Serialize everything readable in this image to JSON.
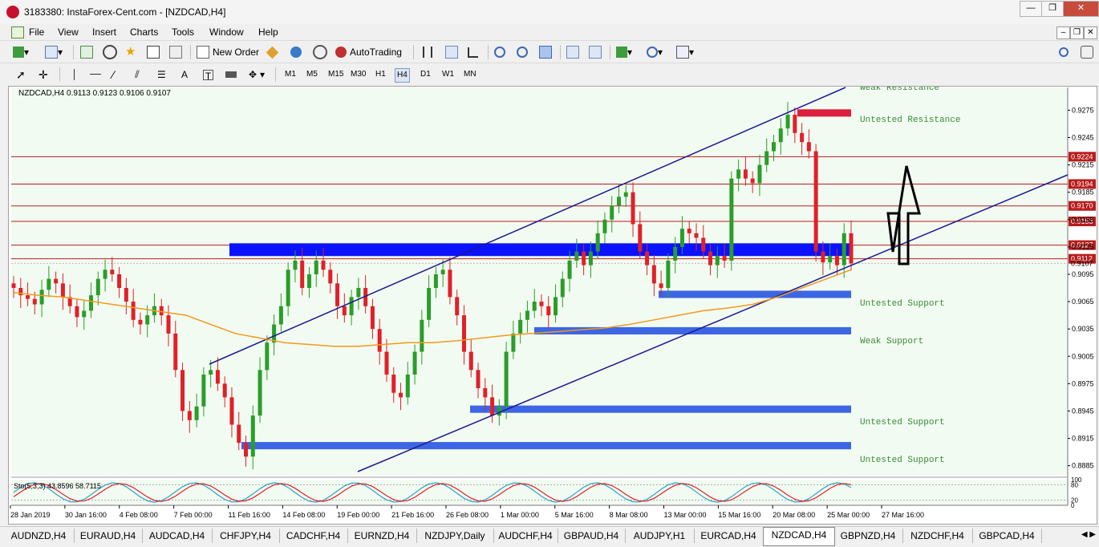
{
  "window": {
    "title": "3183380: InstaForex-Cent.com - [NZDCAD,H4]"
  },
  "menu": [
    "File",
    "View",
    "Insert",
    "Charts",
    "Tools",
    "Window",
    "Help"
  ],
  "toolbar": {
    "new_order": "New Order",
    "autotrading": "AutoTrading"
  },
  "timeframes": [
    "M1",
    "M5",
    "M15",
    "M30",
    "H1",
    "H4",
    "D1",
    "W1",
    "MN"
  ],
  "active_timeframe": "H4",
  "chart": {
    "header": "NZDCAD,H4  0.9113 0.9123 0.9106 0.9107",
    "indicator_label": "Sto(5,3,3) 43.8596 58.7115",
    "osc_ticks": [
      "100",
      "80",
      "20",
      "0"
    ]
  },
  "chart_data": {
    "type": "candlestick",
    "symbol": "NZDCAD",
    "timeframe": "H4",
    "ohlc": {
      "open": 0.9113,
      "high": 0.9123,
      "low": 0.9106,
      "close": 0.9107
    },
    "ylim": [
      0.8875,
      0.93
    ],
    "y_ticks": [
      "0.9275",
      "0.9245",
      "0.9215",
      "0.9185",
      "0.9155",
      "0.9125",
      "0.9095",
      "0.9065",
      "0.9035",
      "0.9005",
      "0.8975",
      "0.8945",
      "0.8915",
      "0.8885"
    ],
    "x_labels": [
      "28 Jan 2019",
      "30 Jan 16:00",
      "4 Feb 08:00",
      "7 Feb 00:00",
      "11 Feb 16:00",
      "14 Feb 08:00",
      "19 Feb 00:00",
      "21 Feb 16:00",
      "26 Feb 08:00",
      "1 Mar 00:00",
      "5 Mar 16:00",
      "8 Mar 08:00",
      "13 Mar 00:00",
      "15 Mar 16:00",
      "20 Mar 08:00",
      "25 Mar 00:00",
      "27 Mar 16:00"
    ],
    "horizontal_levels": [
      {
        "price": 0.9224,
        "label": "0.9224"
      },
      {
        "price": 0.9194,
        "label": "0.9194"
      },
      {
        "price": 0.917,
        "label": "0.9170"
      },
      {
        "price": 0.9153,
        "label": "0.9153"
      },
      {
        "price": 0.9127,
        "label": "0.9127"
      },
      {
        "price": 0.9112,
        "label": "0.9112"
      }
    ],
    "current_price": {
      "price": 0.9107,
      "label": "0.9107"
    },
    "zones": [
      {
        "label": "Weak Resistance",
        "price": 0.93
      },
      {
        "label": "Untested Resistance",
        "price": 0.927
      },
      {
        "label": "Untested Support",
        "price": 0.9073
      },
      {
        "label": "Weak Support",
        "price": 0.9033
      },
      {
        "label": "Untested Support",
        "price": 0.8947
      },
      {
        "label": "Untested Support",
        "price": 0.8907
      }
    ],
    "closes": [
      0.908,
      0.9072,
      0.9068,
      0.9062,
      0.9078,
      0.909,
      0.9085,
      0.907,
      0.906,
      0.9048,
      0.9055,
      0.9072,
      0.909,
      0.91,
      0.9095,
      0.908,
      0.9065,
      0.9045,
      0.904,
      0.905,
      0.906,
      0.905,
      0.903,
      0.899,
      0.8945,
      0.8935,
      0.895,
      0.8985,
      0.899,
      0.8975,
      0.896,
      0.893,
      0.891,
      0.8895,
      0.894,
      0.899,
      0.902,
      0.904,
      0.906,
      0.91,
      0.911,
      0.908,
      0.9095,
      0.911,
      0.91,
      0.9085,
      0.906,
      0.905,
      0.907,
      0.908,
      0.906,
      0.9035,
      0.901,
      0.8985,
      0.8965,
      0.896,
      0.8985,
      0.901,
      0.9045,
      0.908,
      0.9095,
      0.91,
      0.907,
      0.905,
      0.901,
      0.899,
      0.897,
      0.896,
      0.894,
      0.895,
      0.901,
      0.903,
      0.9045,
      0.9055,
      0.9065,
      0.906,
      0.905,
      0.907,
      0.909,
      0.911,
      0.912,
      0.9105,
      0.912,
      0.914,
      0.9155,
      0.917,
      0.918,
      0.9185,
      0.915,
      0.912,
      0.9105,
      0.9085,
      0.908,
      0.911,
      0.9125,
      0.9145,
      0.914,
      0.9135,
      0.912,
      0.9105,
      0.9115,
      0.911,
      0.92,
      0.921,
      0.92,
      0.9195,
      0.9215,
      0.923,
      0.924,
      0.9255,
      0.927,
      0.925,
      0.924,
      0.923,
      0.912,
      0.9108,
      0.9115,
      0.9105,
      0.914,
      0.9107
    ],
    "ma_values": [
      0.9075,
      0.9072,
      0.907,
      0.9066,
      0.9062,
      0.9058,
      0.9054,
      0.905,
      0.904,
      0.903,
      0.9025,
      0.902,
      0.9018,
      0.9016,
      0.9016,
      0.9018,
      0.902,
      0.902,
      0.9022,
      0.9025,
      0.9028,
      0.903,
      0.9032,
      0.9034,
      0.9036,
      0.904,
      0.9045,
      0.905,
      0.9055,
      0.9058,
      0.9062,
      0.907,
      0.908,
      0.909,
      0.91
    ],
    "ylim_osc": [
      0,
      100
    ]
  },
  "symbol_tabs": [
    "AUDNZD,H4",
    "EURAUD,H4",
    "AUDCAD,H4",
    "CHFJPY,H4",
    "CADCHF,H4",
    "EURNZD,H4",
    "NZDJPY,Daily",
    "AUDCHF,H4",
    "GBPAUD,H4",
    "AUDJPY,H1",
    "EURCAD,H4",
    "NZDCAD,H4",
    "GBPNZD,H4",
    "NZDCHF,H4",
    "GBPCAD,H4"
  ],
  "active_tab": "NZDCAD,H4",
  "colors": {
    "bull": "#2a9d2a",
    "bear": "#e0202a",
    "chart_bg": "#f2fbf1",
    "zone": "#3d66e4",
    "dark_zone": "#0a12ff",
    "level": "#b81c1c",
    "trend": "#1a1a8e",
    "ma": "#f29a1c",
    "label_green": "#3a8a3a"
  }
}
